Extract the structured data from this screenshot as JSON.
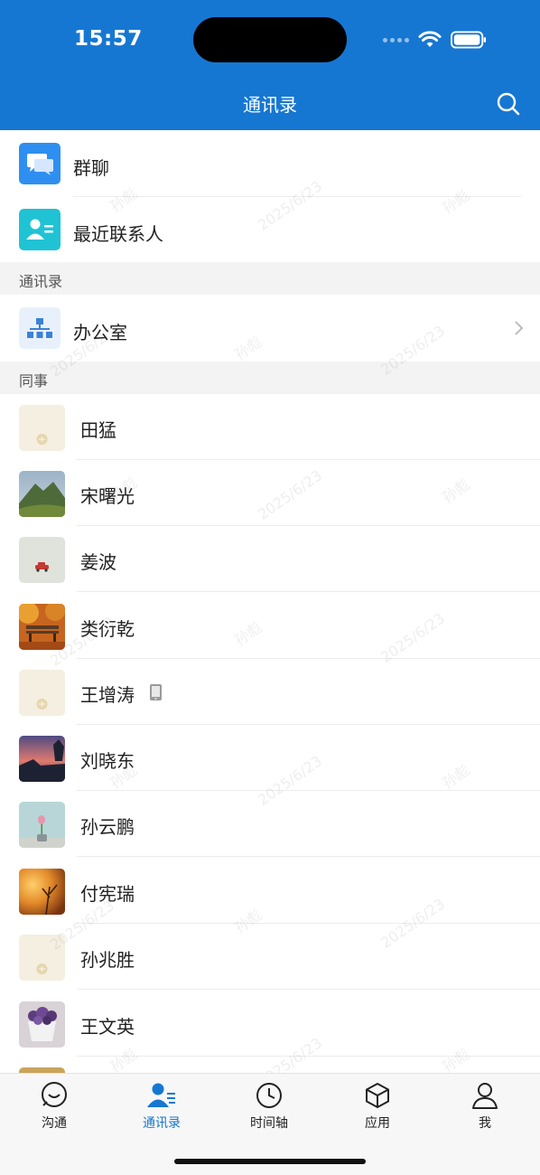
{
  "status_bar": {
    "time": "15:57"
  },
  "header": {
    "title": "通讯录"
  },
  "quick_items": [
    {
      "label": "群聊"
    },
    {
      "label": "最近联系人"
    }
  ],
  "sections": {
    "directory": "通讯录",
    "colleagues": "同事"
  },
  "directory_item": {
    "label": "办公室"
  },
  "contacts": [
    {
      "name": "田猛",
      "avatar": "default"
    },
    {
      "name": "宋曙光",
      "avatar": "mountain"
    },
    {
      "name": "姜波",
      "avatar": "red-car"
    },
    {
      "name": "类衍乾",
      "avatar": "autumn-bench"
    },
    {
      "name": "王增涛",
      "avatar": "default",
      "device": "tablet-icon"
    },
    {
      "name": "刘晓东",
      "avatar": "sunset-beach"
    },
    {
      "name": "孙云鹏",
      "avatar": "tulip"
    },
    {
      "name": "付宪瑞",
      "avatar": "orange-sunset"
    },
    {
      "name": "孙兆胜",
      "avatar": "default"
    },
    {
      "name": "王文英",
      "avatar": "purple-flowers"
    }
  ],
  "watermark": {
    "name": "孙彪",
    "date": "2025/6/23"
  },
  "tabs": [
    {
      "label": "沟通",
      "icon": "chat-icon",
      "active": false
    },
    {
      "label": "通讯录",
      "icon": "contacts-icon",
      "active": true
    },
    {
      "label": "时间轴",
      "icon": "clock-icon",
      "active": false
    },
    {
      "label": "应用",
      "icon": "cube-icon",
      "active": false
    },
    {
      "label": "我",
      "icon": "person-icon",
      "active": false
    }
  ],
  "colors": {
    "brand": "#1677d2",
    "header_bg": "#1677d2",
    "section_bg": "#f3f3f3"
  }
}
